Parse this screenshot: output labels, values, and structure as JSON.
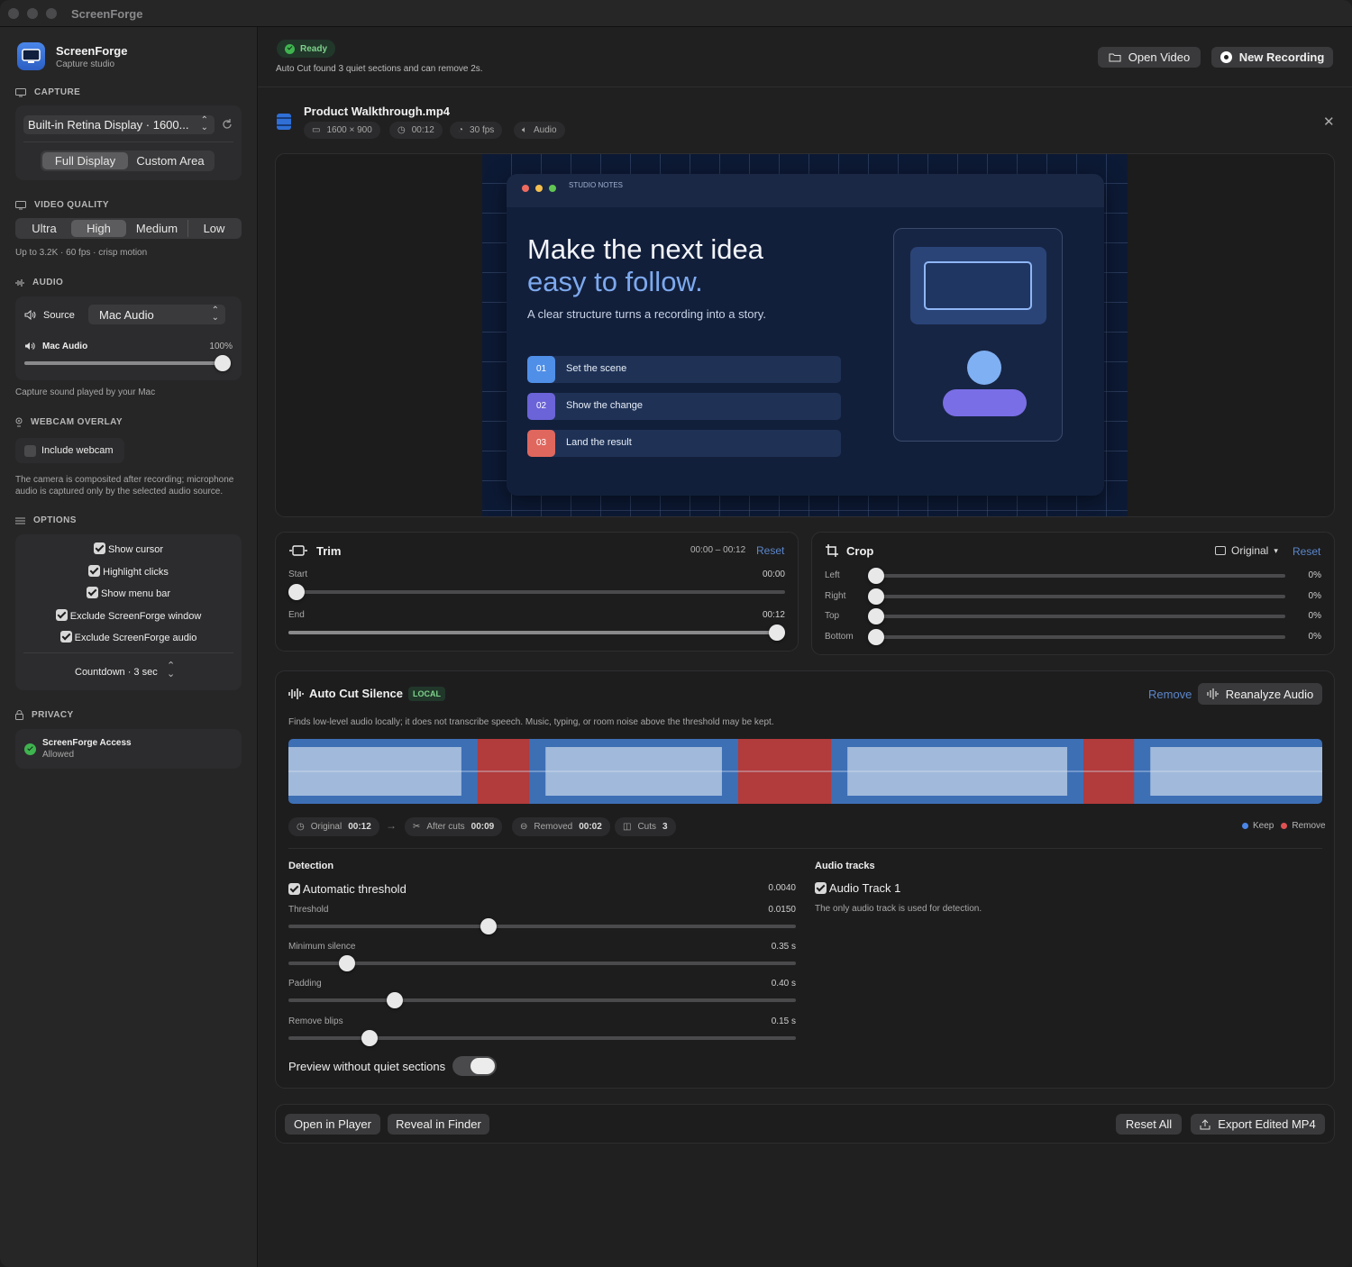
{
  "window": {
    "title": "ScreenForge"
  },
  "sidebar": {
    "app_name": "ScreenForge",
    "app_subtitle": "Capture studio",
    "capture": {
      "heading": "CAPTURE",
      "display_select": "Built-in Retina Display · 1600...",
      "modes": [
        "Full Display",
        "Custom Area"
      ],
      "selected_mode": "Full Display"
    },
    "video_quality": {
      "heading": "VIDEO QUALITY",
      "options": [
        "Ultra",
        "High",
        "Medium",
        "Low"
      ],
      "selected": "High",
      "hint": "Up to 3.2K · 60 fps · crisp motion"
    },
    "audio": {
      "heading": "AUDIO",
      "source_label": "Source",
      "source_value": "Mac Audio",
      "level_label": "Mac Audio",
      "level_value": "100%",
      "level": 1.0,
      "hint": "Capture sound played by your Mac"
    },
    "webcam": {
      "heading": "WEBCAM OVERLAY",
      "toggle_label": "Include webcam",
      "hint_line1": "The camera is composited after recording; microphone",
      "hint_line2": "audio is captured only by the selected audio source."
    },
    "options": {
      "heading": "OPTIONS",
      "items": [
        "Show cursor",
        "Highlight clicks",
        "Show menu bar",
        "Exclude ScreenForge window",
        "Exclude ScreenForge audio"
      ],
      "countdown": "Countdown · 3 sec"
    },
    "privacy": {
      "heading": "PRIVACY",
      "title": "ScreenForge Access",
      "status": "Allowed"
    }
  },
  "header": {
    "status": "Ready",
    "message": "Auto Cut found 3 quiet sections and can remove 2s.",
    "open_video": "Open Video",
    "new_recording": "New Recording"
  },
  "file": {
    "name": "Product Walkthrough.mp4",
    "resolution": "1600 × 900",
    "duration": "00:12",
    "fps": "30 fps",
    "audio": "Audio"
  },
  "preview": {
    "window_label": "STUDIO NOTES",
    "headline1": "Make the next idea",
    "headline2": "easy to follow.",
    "subline": "A clear structure turns a recording into a story.",
    "steps": [
      {
        "num": "01",
        "label": "Set the scene",
        "color": "#4f8fe8"
      },
      {
        "num": "02",
        "label": "Show the change",
        "color": "#6b63d8"
      },
      {
        "num": "03",
        "label": "Land the result",
        "color": "#e0675e"
      }
    ]
  },
  "trim": {
    "title": "Trim",
    "range": "00:00 – 00:12",
    "reset": "Reset",
    "start_label": "Start",
    "start_value": "00:00",
    "start_pos": 0.0,
    "end_label": "End",
    "end_value": "00:12",
    "end_pos": 1.0
  },
  "crop": {
    "title": "Crop",
    "aspect": "Original",
    "reset": "Reset",
    "rows": [
      {
        "label": "Left",
        "value": "0%"
      },
      {
        "label": "Right",
        "value": "0%"
      },
      {
        "label": "Top",
        "value": "0%"
      },
      {
        "label": "Bottom",
        "value": "0%"
      }
    ]
  },
  "autocut": {
    "title": "Auto Cut Silence",
    "badge": "LOCAL",
    "remove": "Remove",
    "reanalyze": "Reanalyze Audio",
    "description": "Finds low-level audio locally; it does not transcribe speech. Music, typing, or room noise above the threshold may be kept.",
    "stats": {
      "original_label": "Original",
      "original": "00:12",
      "after_label": "After cuts",
      "after": "00:09",
      "removed_label": "Removed",
      "removed": "00:02",
      "cuts_label": "Cuts",
      "cuts": "3"
    },
    "legend_keep": "Keep",
    "legend_remove": "Remove",
    "colors": {
      "keep": "#3d6fb5",
      "remove": "#b23b3c",
      "wave": "#a9c0de"
    },
    "removed_segments": [
      [
        0.183,
        0.233
      ],
      [
        0.435,
        0.525
      ],
      [
        0.769,
        0.818
      ]
    ],
    "detection": {
      "heading": "Detection",
      "auto_label": "Automatic threshold",
      "auto_value": "0.0040",
      "sliders": [
        {
          "label": "Threshold",
          "value": "0.0150",
          "pos": 0.395
        },
        {
          "label": "Minimum silence",
          "value": "0.35 s",
          "pos": 0.115
        },
        {
          "label": "Padding",
          "value": "0.40 s",
          "pos": 0.21
        },
        {
          "label": "Remove blips",
          "value": "0.15 s",
          "pos": 0.16
        }
      ],
      "preview_toggle": "Preview without quiet sections"
    },
    "tracks": {
      "heading": "Audio tracks",
      "track": "Audio Track 1",
      "hint": "The only audio track is used for detection."
    }
  },
  "footer": {
    "open_player": "Open in Player",
    "reveal": "Reveal in Finder",
    "reset_all": "Reset All",
    "export": "Export Edited MP4"
  }
}
